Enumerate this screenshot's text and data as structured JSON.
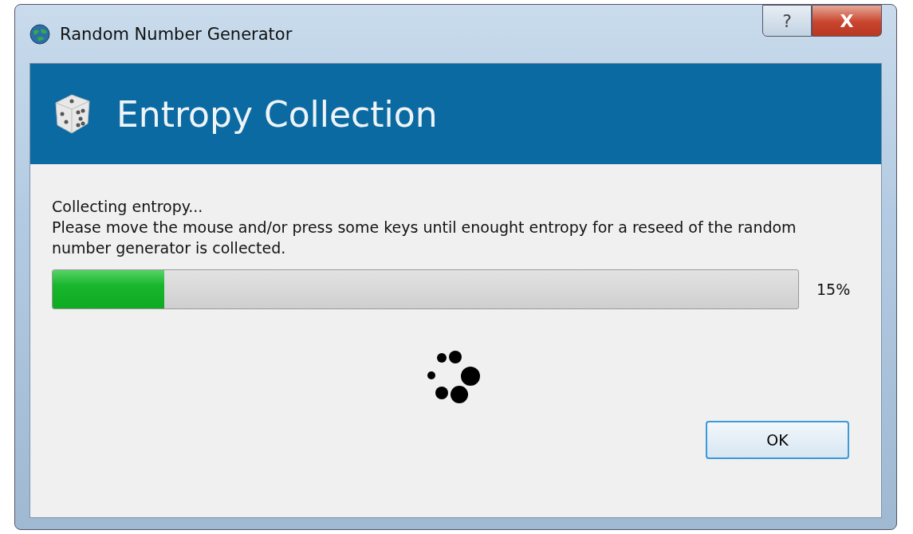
{
  "window": {
    "title": "Random Number Generator",
    "help_button": "?",
    "close_button": "X"
  },
  "header": {
    "title": "Entropy Collection"
  },
  "message": {
    "status": "Collecting entropy...",
    "instruction": "Please move the mouse and/or press some keys until enought entropy for a reseed of the random number generator is collected."
  },
  "progress": {
    "level": 0.15,
    "reading": "15%"
  },
  "buttons": [
    "OK"
  ]
}
